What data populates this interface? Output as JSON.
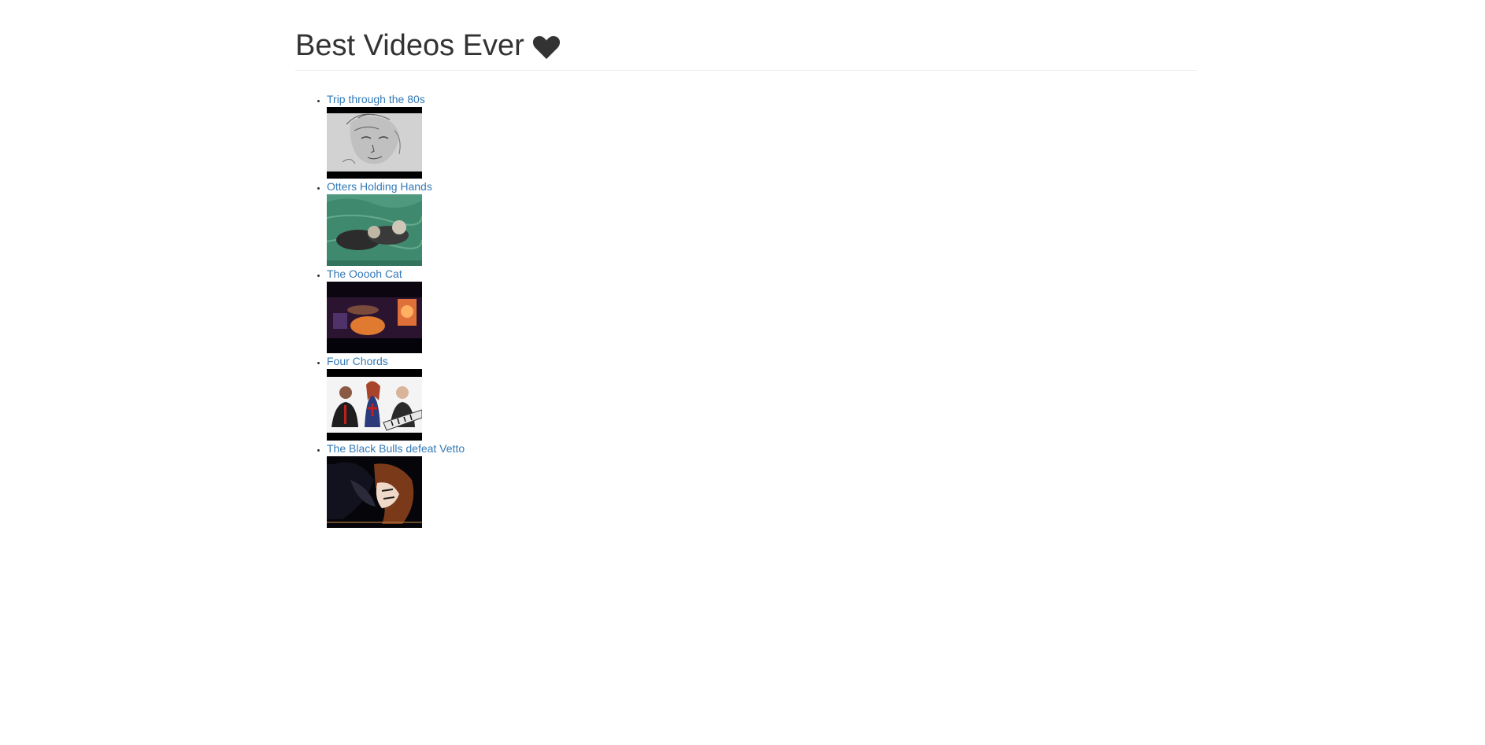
{
  "page": {
    "title": "Best Videos Ever",
    "title_icon": "heart-icon"
  },
  "videos": [
    {
      "title": "Trip through the 80s",
      "thumbnail": "pencil-sketch-face"
    },
    {
      "title": "Otters Holding Hands",
      "thumbnail": "otters-in-water"
    },
    {
      "title": "The Ooooh Cat",
      "thumbnail": "dark-scene-cat"
    },
    {
      "title": "Four Chords",
      "thumbnail": "comedy-band"
    },
    {
      "title": "The Black Bulls defeat Vetto",
      "thumbnail": "anime-fight"
    }
  ],
  "colors": {
    "link": "#337ab7",
    "text": "#333333",
    "rule": "#eeeeee"
  }
}
